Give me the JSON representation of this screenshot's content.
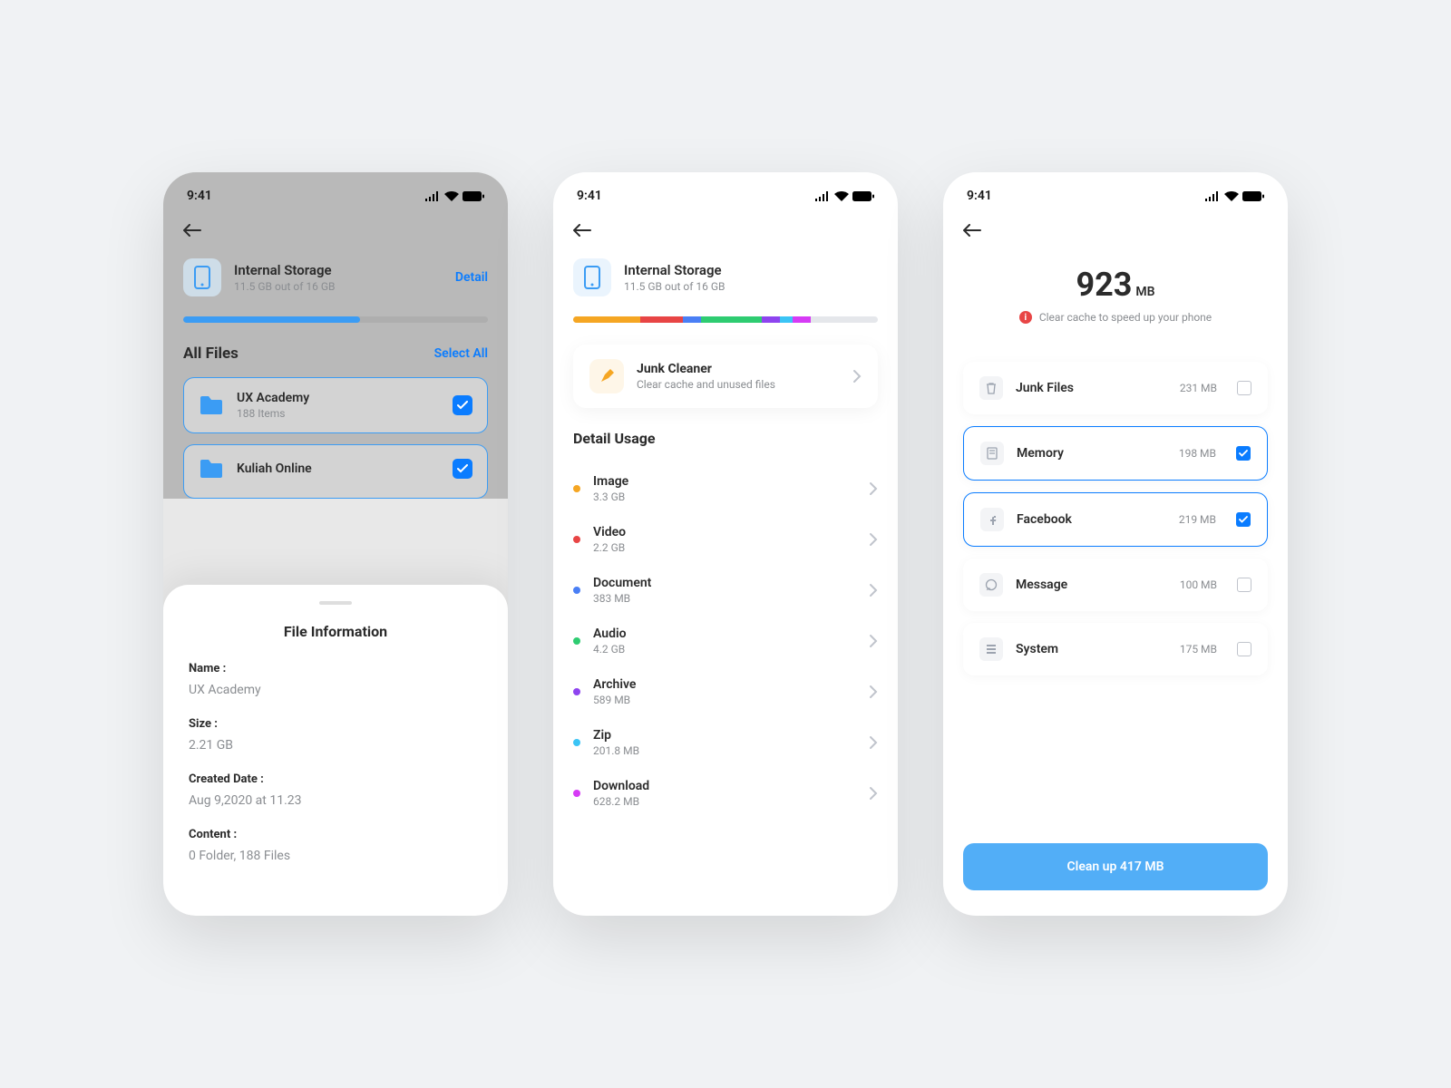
{
  "status": {
    "time": "9:41"
  },
  "screen1": {
    "storage": {
      "title": "Internal Storage",
      "sub": "11.5 GB out of 16 GB",
      "detail": "Detail"
    },
    "section": {
      "title": "All Files",
      "select_all": "Select All"
    },
    "files": [
      {
        "name": "UX Academy",
        "sub": "188 Items"
      },
      {
        "name": "Kuliah Online",
        "sub": ""
      }
    ],
    "sheet": {
      "title": "File Information",
      "name_label": "Name :",
      "name_value": "UX Academy",
      "size_label": "Size :",
      "size_value": "2.21 GB",
      "date_label": "Created Date :",
      "date_value": "Aug 9,2020 at 11.23",
      "content_label": "Content :",
      "content_value": "0 Folder, 188 Files"
    }
  },
  "screen2": {
    "storage": {
      "title": "Internal Storage",
      "sub": "11.5 GB out of 16 GB"
    },
    "junk": {
      "title": "Junk Cleaner",
      "sub": "Clear cache and unused files"
    },
    "detail_title": "Detail Usage",
    "usage": [
      {
        "name": "Image",
        "size": "3.3 GB",
        "color": "#f5a623"
      },
      {
        "name": "Video",
        "size": "2.2 GB",
        "color": "#e84545"
      },
      {
        "name": "Document",
        "size": "383 MB",
        "color": "#4a7ff5"
      },
      {
        "name": "Audio",
        "size": "4.2 GB",
        "color": "#2ecc71"
      },
      {
        "name": "Archive",
        "size": "589 MB",
        "color": "#8e44ef"
      },
      {
        "name": "Zip",
        "size": "201.8 MB",
        "color": "#3bc4f5"
      },
      {
        "name": "Download",
        "size": "628.2 MB",
        "color": "#d63bf5"
      }
    ]
  },
  "screen3": {
    "size": "923",
    "unit": "MB",
    "subtitle": "Clear cache to speed up your phone",
    "items": [
      {
        "name": "Junk Files",
        "size": "231 MB",
        "checked": false
      },
      {
        "name": "Memory",
        "size": "198 MB",
        "checked": true
      },
      {
        "name": "Facebook",
        "size": "219 MB",
        "checked": true
      },
      {
        "name": "Message",
        "size": "100 MB",
        "checked": false
      },
      {
        "name": "System",
        "size": "175 MB",
        "checked": false
      }
    ],
    "button": "Clean up 417 MB"
  }
}
